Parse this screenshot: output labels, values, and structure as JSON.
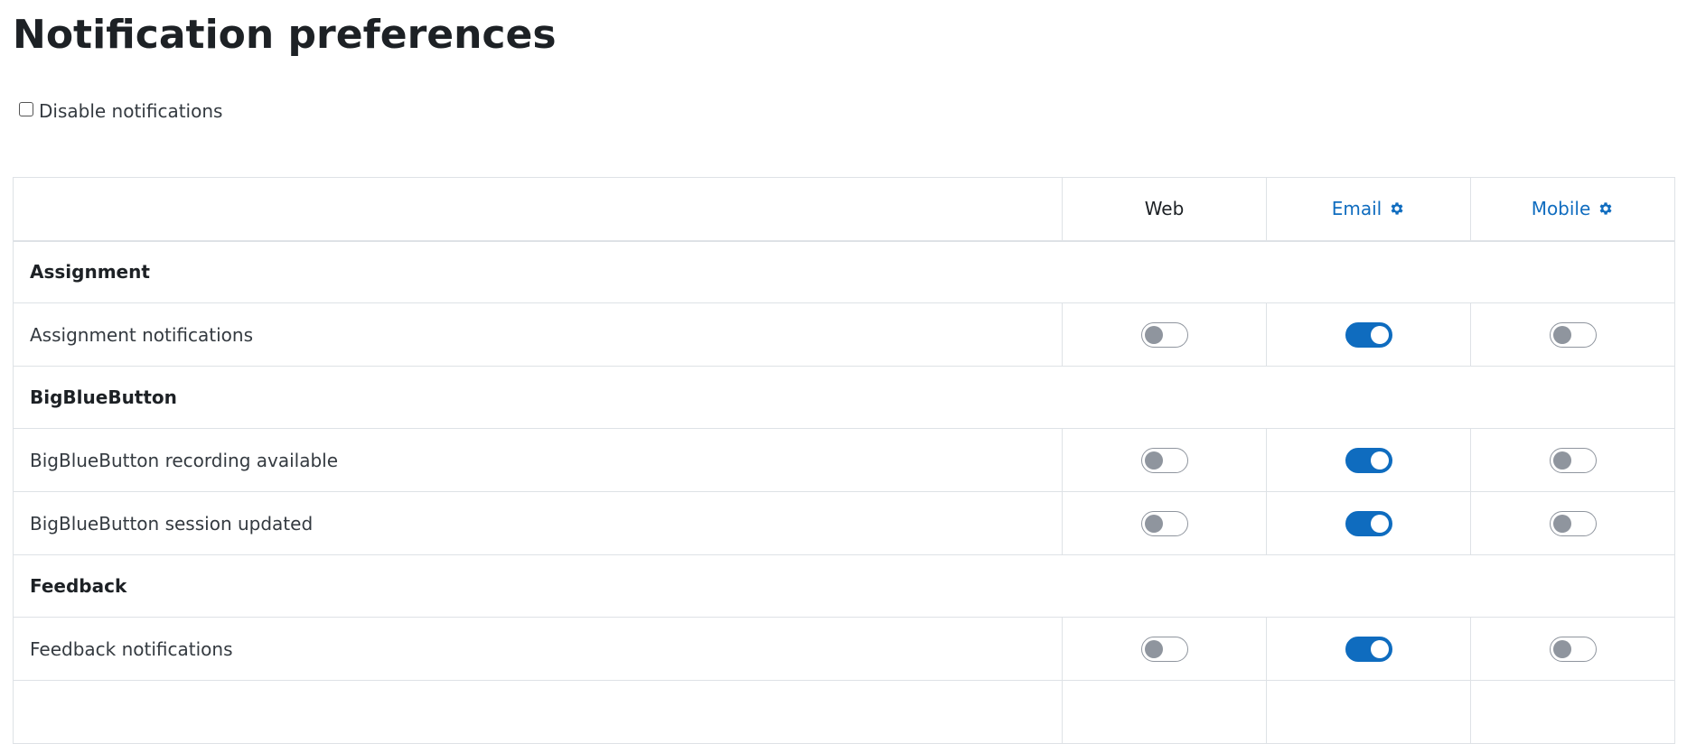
{
  "page_title": "Notification preferences",
  "disable_notifications": {
    "label": "Disable notifications",
    "checked": false
  },
  "table": {
    "columns": [
      {
        "label": "Web",
        "link": false,
        "icon": ""
      },
      {
        "label": "Email",
        "link": true,
        "icon": "gear-icon"
      },
      {
        "label": "Mobile",
        "link": true,
        "icon": "gear-icon"
      }
    ],
    "groups": [
      {
        "name": "Assignment",
        "items": [
          {
            "label": "Assignment notifications",
            "web": false,
            "email": true,
            "mobile": false
          }
        ]
      },
      {
        "name": "BigBlueButton",
        "items": [
          {
            "label": "BigBlueButton recording available",
            "web": false,
            "email": true,
            "mobile": false
          },
          {
            "label": "BigBlueButton session updated",
            "web": false,
            "email": true,
            "mobile": false
          }
        ]
      },
      {
        "name": "Feedback",
        "items": [
          {
            "label": "Feedback notifications",
            "web": false,
            "email": true,
            "mobile": false
          }
        ]
      }
    ]
  },
  "colors": {
    "accent": "#0f6cbf",
    "toggle_off": "#8f959e",
    "border": "#dee2e6"
  }
}
